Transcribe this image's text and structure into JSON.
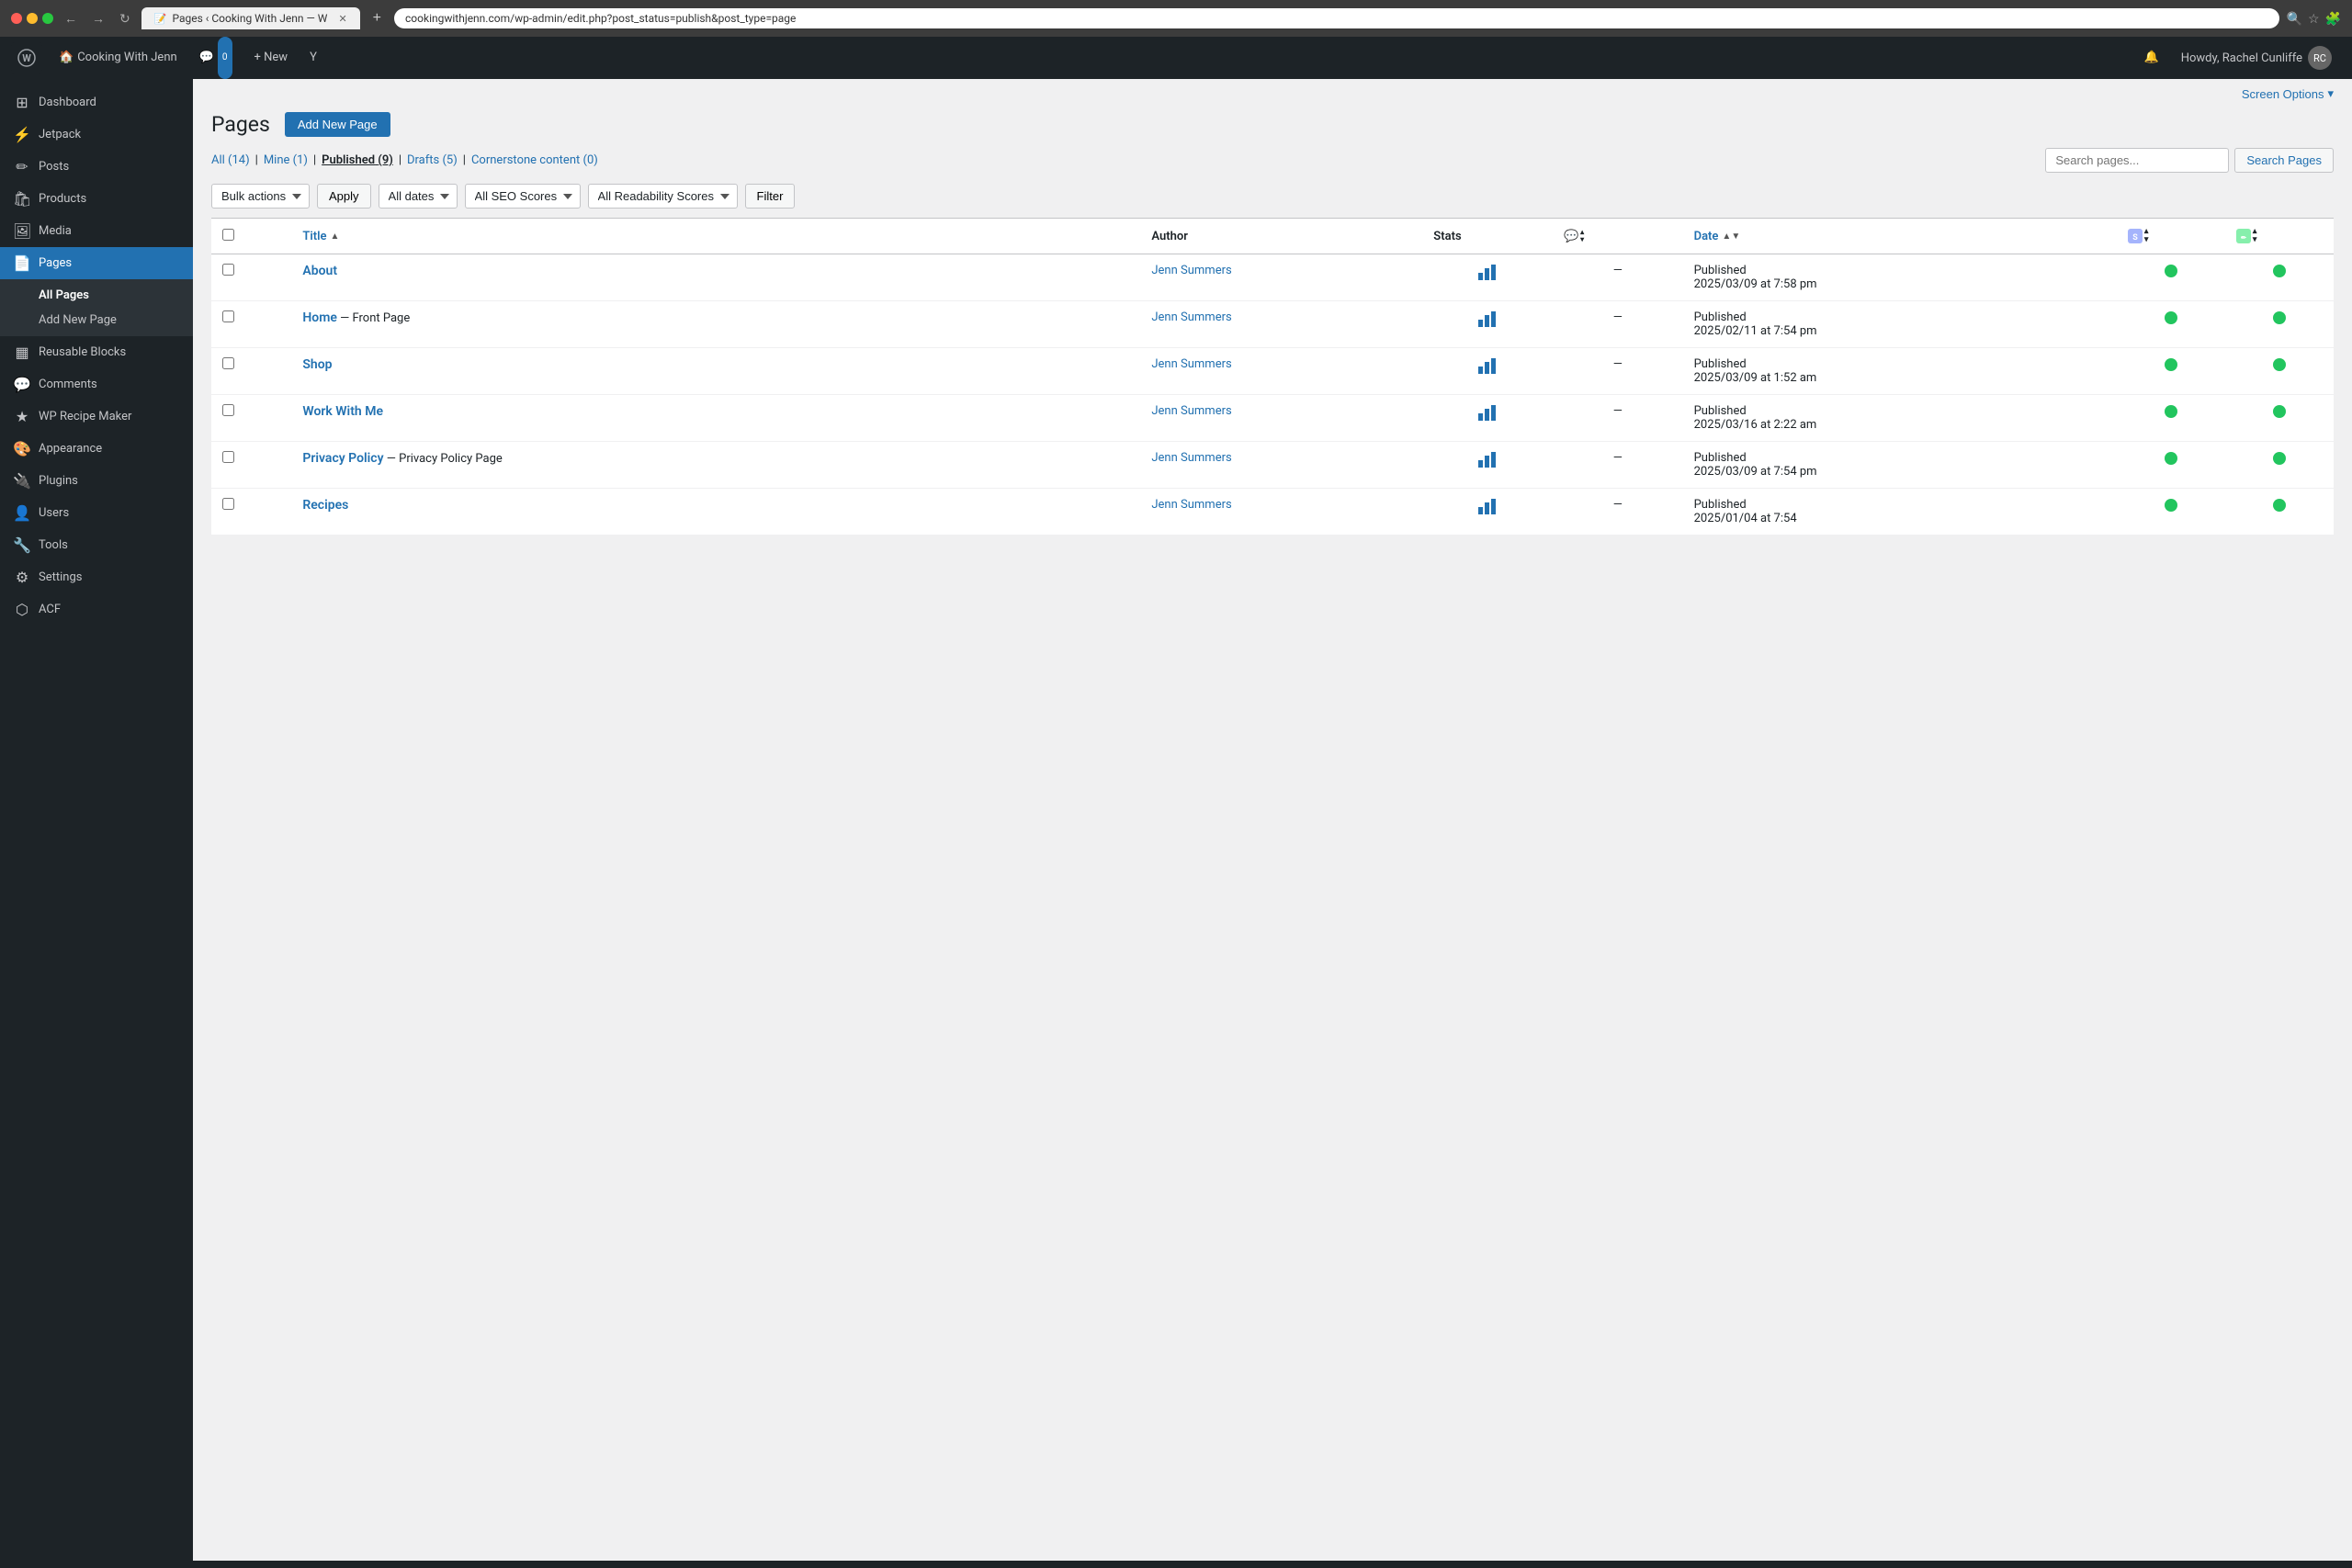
{
  "browser": {
    "tab_title": "Pages ‹ Cooking With Jenn — W",
    "url": "cookingwithjenn.com/wp-admin/edit.php?post_status=publish&post_type=page"
  },
  "admin_bar": {
    "site_name": "Cooking With Jenn",
    "comments_count": "0",
    "new_label": "+ New",
    "howdy": "Howdy, Rachel Cunliffe"
  },
  "screen_options": {
    "label": "Screen Options"
  },
  "page": {
    "title": "Pages",
    "add_new_label": "Add New Page"
  },
  "filters": {
    "all_label": "All",
    "all_count": "(14)",
    "mine_label": "Mine",
    "mine_count": "(1)",
    "published_label": "Published",
    "published_count": "(9)",
    "drafts_label": "Drafts",
    "drafts_count": "(5)",
    "cornerstone_label": "Cornerstone content",
    "cornerstone_count": "(0)",
    "search_placeholder": "",
    "search_btn_label": "Search Pages"
  },
  "table_controls": {
    "bulk_actions_label": "Bulk actions",
    "apply_label": "Apply",
    "all_dates_label": "All dates",
    "all_seo_label": "All SEO Scores",
    "all_readability_label": "All Readability Scores",
    "filter_label": "Filter"
  },
  "table": {
    "headers": {
      "title": "Title",
      "author": "Author",
      "stats": "Stats",
      "comments": "",
      "date": "Date",
      "seo": "",
      "readability": ""
    },
    "rows": [
      {
        "id": 1,
        "title": "About",
        "subtitle": "",
        "author": "Jenn Summers",
        "date_status": "Published",
        "date": "2025/03/09 at 7:58 pm",
        "comments": "—",
        "seo_green": true,
        "read_green": true
      },
      {
        "id": 2,
        "title": "Home",
        "subtitle": "— Front Page",
        "author": "Jenn Summers",
        "date_status": "Published",
        "date": "2025/02/11  at 7:54 pm",
        "comments": "—",
        "seo_green": true,
        "read_green": true
      },
      {
        "id": 3,
        "title": "Shop",
        "subtitle": "",
        "author": "Jenn Summers",
        "date_status": "Published",
        "date": "2025/03/09 at 1:52 am",
        "comments": "—",
        "seo_green": true,
        "read_green": true
      },
      {
        "id": 4,
        "title": "Work With Me",
        "subtitle": "",
        "author": "Jenn Summers",
        "date_status": "Published",
        "date": "2025/03/16  at 2:22 am",
        "comments": "—",
        "seo_green": true,
        "read_green": true
      },
      {
        "id": 5,
        "title": "Privacy Policy",
        "subtitle": "— Privacy Policy Page",
        "author": "Jenn Summers",
        "date_status": "Published",
        "date": "2025/03/09 at 7:54 pm",
        "comments": "—",
        "seo_green": true,
        "read_green": true
      },
      {
        "id": 6,
        "title": "Recipes",
        "subtitle": "",
        "author": "Jenn Summers",
        "date_status": "Published",
        "date": "2025/01/04 at 7:54",
        "comments": "—",
        "seo_green": true,
        "read_green": true
      }
    ]
  },
  "sidebar": {
    "items": [
      {
        "id": "dashboard",
        "label": "Dashboard",
        "icon": "⊞"
      },
      {
        "id": "jetpack",
        "label": "Jetpack",
        "icon": "⚡"
      },
      {
        "id": "posts",
        "label": "Posts",
        "icon": "✏"
      },
      {
        "id": "products",
        "label": "Products",
        "icon": "🛍"
      },
      {
        "id": "media",
        "label": "Media",
        "icon": "🖼"
      },
      {
        "id": "pages",
        "label": "Pages",
        "icon": "📄"
      },
      {
        "id": "reusable-blocks",
        "label": "Reusable Blocks",
        "icon": "▦"
      },
      {
        "id": "comments",
        "label": "Comments",
        "icon": "💬"
      },
      {
        "id": "wp-recipe-maker",
        "label": "WP Recipe Maker",
        "icon": "★"
      },
      {
        "id": "appearance",
        "label": "Appearance",
        "icon": "🎨"
      },
      {
        "id": "plugins",
        "label": "Plugins",
        "icon": "🔌"
      },
      {
        "id": "users",
        "label": "Users",
        "icon": "👤"
      },
      {
        "id": "tools",
        "label": "Tools",
        "icon": "🔧"
      },
      {
        "id": "settings",
        "label": "Settings",
        "icon": "⚙"
      },
      {
        "id": "acf",
        "label": "ACF",
        "icon": "⬡"
      }
    ],
    "pages_sub": [
      {
        "id": "all-pages",
        "label": "All Pages"
      },
      {
        "id": "add-new-page",
        "label": "Add New Page"
      }
    ]
  }
}
